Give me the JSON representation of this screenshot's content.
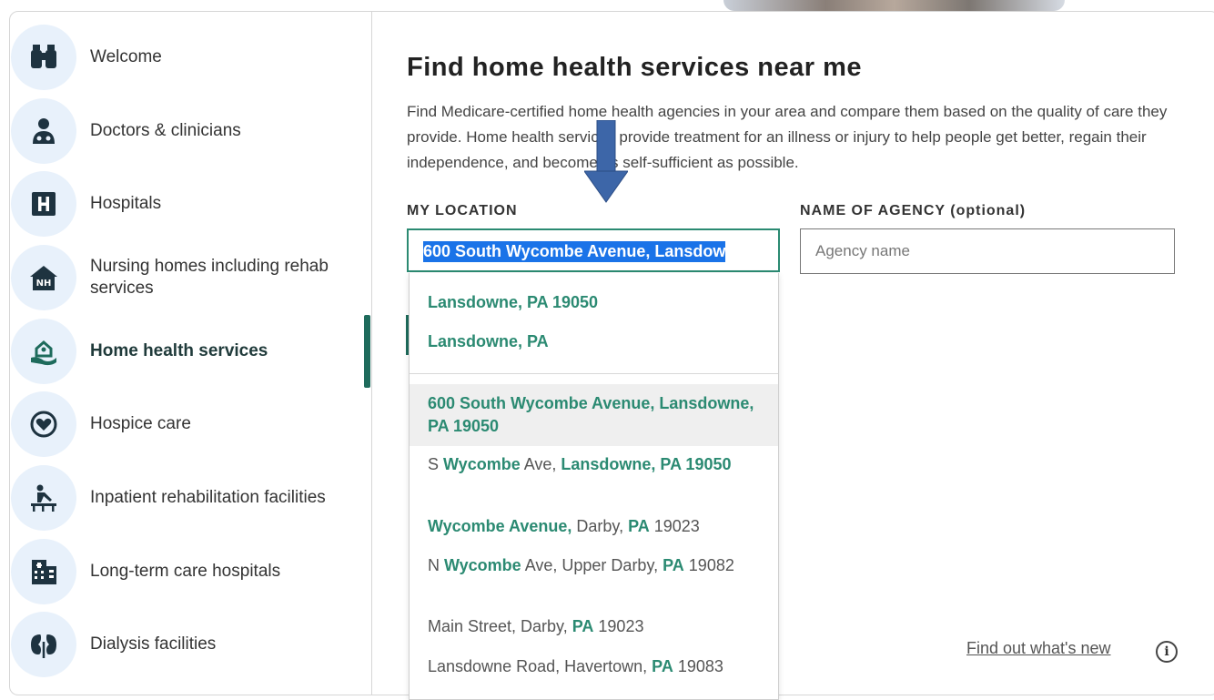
{
  "colors": {
    "accent": "#2b8a72",
    "active_bar": "#1e6b5c",
    "icon_bg": "#e8f1fb",
    "selection": "#1a73e8"
  },
  "sidebar": {
    "items": [
      {
        "label": "Welcome",
        "icon": "binoculars-icon"
      },
      {
        "label": "Doctors & clinicians",
        "icon": "doctor-icon"
      },
      {
        "label": "Hospitals",
        "icon": "hospital-h-icon"
      },
      {
        "label": "Nursing homes including rehab services",
        "icon": "nursing-home-icon"
      },
      {
        "label": "Home health services",
        "icon": "home-health-icon",
        "active": true
      },
      {
        "label": "Hospice care",
        "icon": "hospice-heart-icon"
      },
      {
        "label": "Inpatient rehabilitation facilities",
        "icon": "rehab-icon"
      },
      {
        "label": "Long-term care hospitals",
        "icon": "building-icon"
      },
      {
        "label": "Dialysis facilities",
        "icon": "kidney-icon"
      }
    ]
  },
  "main": {
    "title": "Find home health services near me",
    "description": "Find Medicare-certified home health agencies in your area and compare them based on the quality of care they provide. Home health services provide treatment for an illness or injury to help people get better, regain their independence, and become as self-sufficient as possible.",
    "location_label": "MY LOCATION",
    "location_value": "600 South Wycombe Avenue, Lansdow",
    "agency_label": "NAME OF AGENCY (optional)",
    "agency_placeholder": "Agency name",
    "whats_new": "Find out what's new"
  },
  "dropdown": {
    "recent": [
      "Lansdowne, PA 19050",
      "Lansdowne, PA"
    ],
    "suggestions": [
      {
        "plain1": "",
        "bold1": "600 South Wycombe Avenue, Lansdowne, PA 19050",
        "plain2": ""
      },
      {
        "plain1": "S ",
        "bold1": "Wycombe",
        "plain2": " Ave, ",
        "bold2": "Lansdowne, PA 19050"
      },
      {
        "plain1": "",
        "bold1": "Wycombe Avenue,",
        "plain2": " Darby, ",
        "bold2": "PA",
        "plain3": " 19023"
      },
      {
        "plain1": "N ",
        "bold1": "Wycombe",
        "plain2": " Ave, Upper Darby, ",
        "bold2": "PA",
        "plain3": " 19082"
      },
      {
        "plain1": "Main Street, Darby, ",
        "bold1": "PA",
        "plain2": " 19023"
      },
      {
        "plain1": "Lansdowne Road, Havertown, ",
        "bold1": "PA",
        "plain2": " 19083"
      }
    ]
  }
}
